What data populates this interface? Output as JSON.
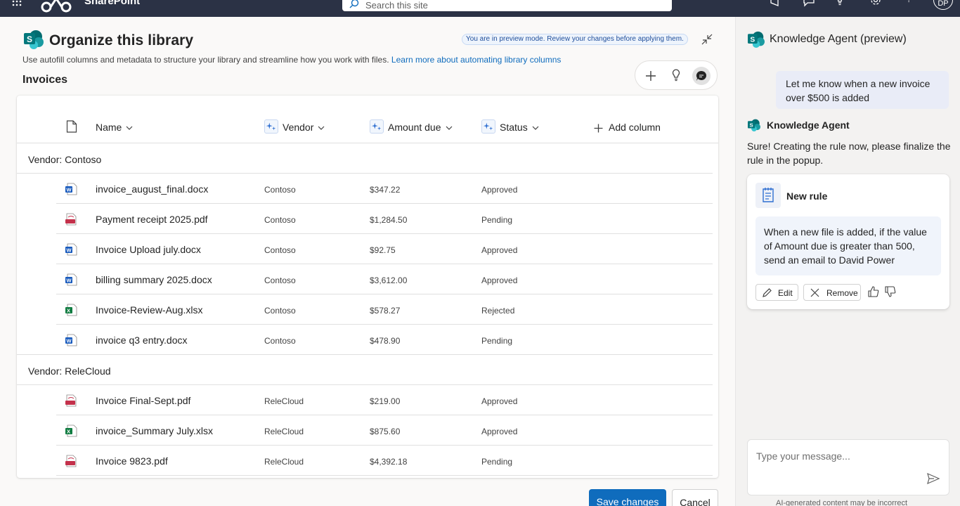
{
  "topbar": {
    "brand": "SharePoint",
    "search_placeholder": "Search this site",
    "user_initials": "DP",
    "icons": [
      "waffle-icon",
      "sharepoint-logo-icon",
      "search-icon",
      "megaphone-icon",
      "feedback-icon",
      "lightbulb-icon",
      "settings-icon",
      "help-icon"
    ]
  },
  "main": {
    "title": "Organize this library",
    "preview_badge": "You are in preview mode. Review your changes before applying them.",
    "subtitle": "Use autofill columns and metadata to structure your library and streamline how you work with files.",
    "learn_more": "Learn more about automating library columns",
    "library_name": "Invoices",
    "columns": {
      "name": "Name",
      "vendor": "Vendor",
      "amount": "Amount due",
      "status": "Status",
      "add_column": "Add column"
    },
    "groups": [
      {
        "label": "Vendor: Contoso",
        "rows": [
          {
            "type": "word",
            "name": "invoice_august_final.docx",
            "vendor": "Contoso",
            "amount": "$347.22",
            "status": "Approved"
          },
          {
            "type": "pdf",
            "name": "Payment receipt 2025.pdf",
            "vendor": "Contoso",
            "amount": "$1,284.50",
            "status": "Pending"
          },
          {
            "type": "word",
            "name": "Invoice Upload july.docx",
            "vendor": "Contoso",
            "amount": "$92.75",
            "status": "Approved"
          },
          {
            "type": "word",
            "name": "billing summary 2025.docx",
            "vendor": "Contoso",
            "amount": "$3,612.00",
            "status": "Approved"
          },
          {
            "type": "excel",
            "name": "Invoice-Review-Aug.xlsx",
            "vendor": "Contoso",
            "amount": "$578.27",
            "status": "Rejected"
          },
          {
            "type": "word",
            "name": "invoice q3 entry.docx",
            "vendor": "Contoso",
            "amount": "$478.90",
            "status": "Pending"
          }
        ]
      },
      {
        "label": "Vendor: ReleCloud",
        "rows": [
          {
            "type": "pdf",
            "name": "Invoice Final-Sept.pdf",
            "vendor": "ReleCloud",
            "amount": "$219.00",
            "status": "Approved"
          },
          {
            "type": "excel",
            "name": "invoice_Summary July.xlsx",
            "vendor": "ReleCloud",
            "amount": "$875.60",
            "status": "Approved"
          },
          {
            "type": "pdf",
            "name": "Invoice 9823.pdf",
            "vendor": "ReleCloud",
            "amount": "$4,392.18",
            "status": "Pending"
          }
        ]
      }
    ],
    "save_label": "Save changes",
    "cancel_label": "Cancel"
  },
  "agent": {
    "title": "Knowledge Agent (preview)",
    "user_message": "Let me know when a new invoice over $500 is added",
    "agent_name": "Knowledge Agent",
    "reply": "Sure! Creating the rule now, please finalize the rule in the popup.",
    "rule": {
      "title": "New rule",
      "body": "When a new file is added, if the value of Amount due is greater than 500, send an email to David Power",
      "edit_label": "Edit",
      "remove_label": "Remove"
    },
    "input_placeholder": "Type your message...",
    "disclaimer": "AI-generated content may be incorrect"
  },
  "colors": {
    "topbar": "#2b3245",
    "accent": "#0f6cbd",
    "word": "#185abd",
    "excel": "#107c41",
    "pdf": "#c4314b"
  }
}
